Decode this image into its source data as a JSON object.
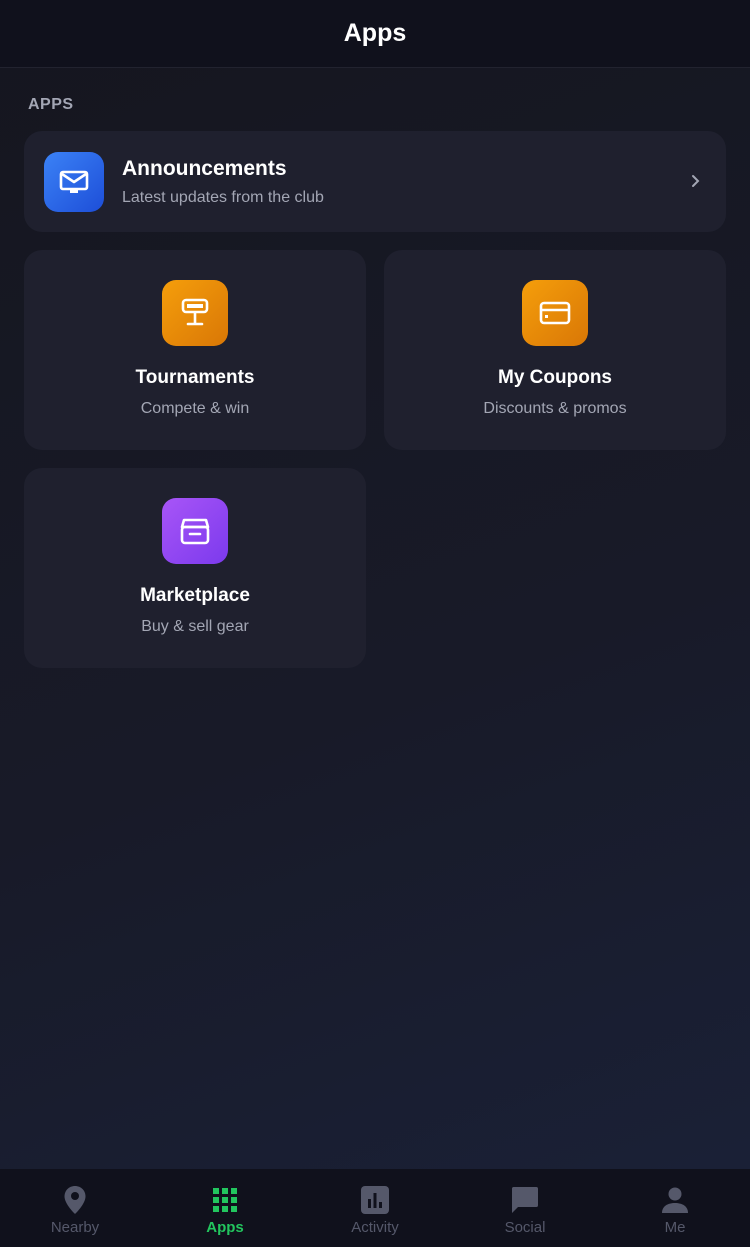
{
  "header": {
    "title": "Apps"
  },
  "section": {
    "label": "APPS"
  },
  "announcements": {
    "title": "Announcements",
    "subtitle": "Latest updates from the club",
    "icon": "envelope-icon",
    "color": "#3b82f6"
  },
  "tiles": [
    {
      "title": "Tournaments",
      "subtitle": "Compete & win",
      "icon": "trophy-icon",
      "color": "#f59e0b"
    },
    {
      "title": "My Coupons",
      "subtitle": "Discounts & promos",
      "icon": "card-icon",
      "color": "#f59e0b"
    },
    {
      "title": "Marketplace",
      "subtitle": "Buy & sell gear",
      "icon": "archive-box-icon",
      "color": "#a855f7"
    }
  ],
  "tabs": [
    {
      "label": "Nearby",
      "icon": "location-pin-icon",
      "active": false
    },
    {
      "label": "Apps",
      "icon": "grid-icon",
      "active": true
    },
    {
      "label": "Activity",
      "icon": "bar-chart-icon",
      "active": false
    },
    {
      "label": "Social",
      "icon": "chat-bubble-icon",
      "active": false
    },
    {
      "label": "Me",
      "icon": "person-icon",
      "active": false
    }
  ],
  "colors": {
    "accent": "#22c55e",
    "inactive": "#55586a",
    "background": "#15161f",
    "card": "#1f202e"
  }
}
